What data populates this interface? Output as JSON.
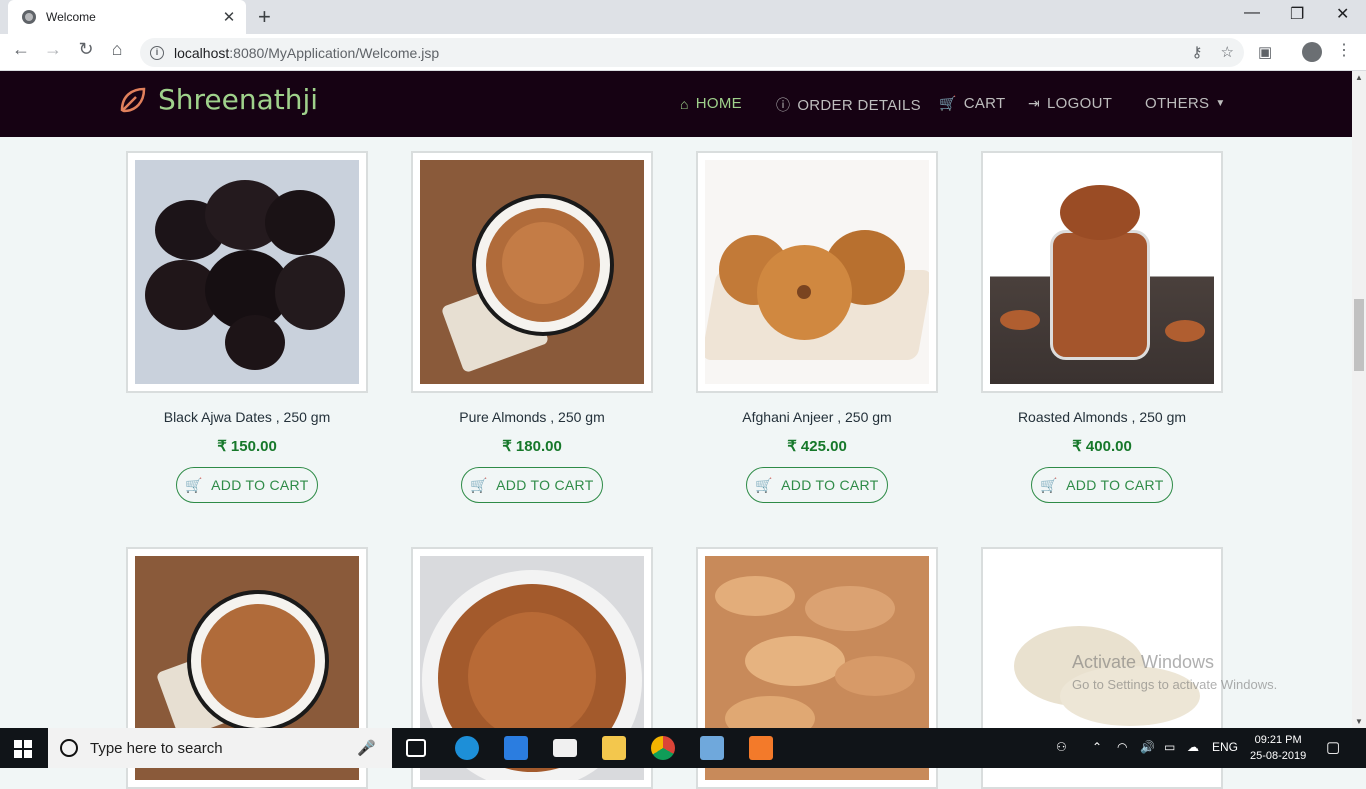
{
  "browser": {
    "tab_title": "Welcome",
    "tab_close": "✕",
    "new_tab": "+",
    "url_host": "localhost",
    "url_rest": ":8080/MyApplication/Welcome.jsp",
    "win_min": "—",
    "win_max": "❐",
    "win_close": "✕"
  },
  "site": {
    "brand": "Shreenathji",
    "nav": [
      {
        "label": "HOME",
        "icon": "home-icon",
        "active": true
      },
      {
        "label": "ORDER DETAILS",
        "icon": "info-icon"
      },
      {
        "label": "CART",
        "icon": "cart-icon"
      },
      {
        "label": "LOGOUT",
        "icon": "logout-icon"
      },
      {
        "label": "OTHERS",
        "icon": "caret-down-icon"
      }
    ]
  },
  "products": [
    {
      "name": "Black Ajwa Dates , 250 gm",
      "price": "₹ 150.00",
      "button": "ADD TO CART"
    },
    {
      "name": "Pure Almonds , 250 gm",
      "price": "₹ 180.00",
      "button": "ADD TO CART"
    },
    {
      "name": "Afghani Anjeer , 250 gm",
      "price": "₹ 425.00",
      "button": "ADD TO CART"
    },
    {
      "name": "Roasted Almonds , 250 gm",
      "price": "₹ 400.00",
      "button": "ADD TO CART"
    }
  ],
  "watermark": {
    "line1": "Activate Windows",
    "line2": "Go to Settings to activate Windows."
  },
  "taskbar": {
    "search_placeholder": "Type here to search",
    "language": "ENG",
    "time": "09:21 PM",
    "date": "25-08-2019"
  },
  "colors": {
    "header_bg": "#160213",
    "brand": "#9fd18b",
    "price": "#16782a",
    "button": "#2e8b47"
  }
}
